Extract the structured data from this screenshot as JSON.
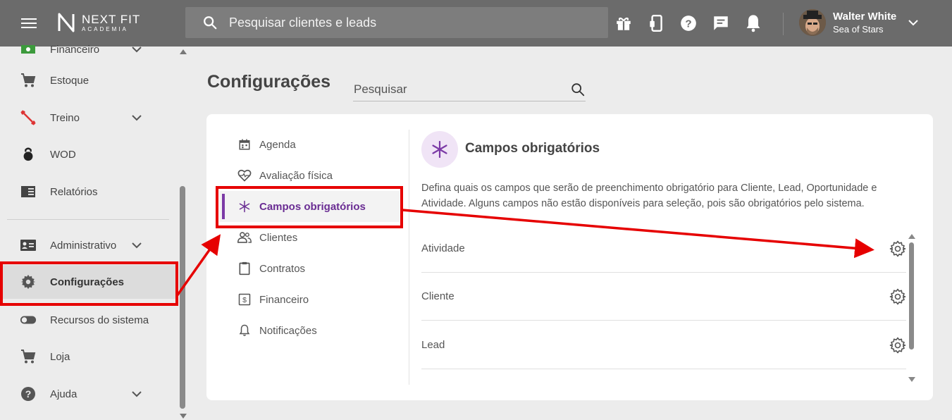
{
  "topbar": {
    "logo_line1": "NEXT FIT",
    "logo_line2": "ACADEMIA",
    "search_placeholder": "Pesquisar clientes e leads",
    "icons": [
      "gift-icon",
      "mobile-icon",
      "help-icon",
      "chat-icon",
      "bell-icon"
    ],
    "user_name": "Walter White",
    "user_org": "Sea of Stars"
  },
  "sidebar": {
    "items": [
      {
        "label": "Financeiro",
        "icon": "money-icon",
        "chevron": true
      },
      {
        "label": "Estoque",
        "icon": "cart-icon",
        "chevron": false
      },
      {
        "label": "Treino",
        "icon": "dumbbell-icon",
        "chevron": true
      },
      {
        "label": "WOD",
        "icon": "kettlebell-icon",
        "chevron": false
      },
      {
        "label": "Relatórios",
        "icon": "report-icon",
        "chevron": false
      },
      {
        "label": "Administrativo",
        "icon": "id-card-icon",
        "chevron": true
      },
      {
        "label": "Configurações",
        "icon": "gear-icon",
        "chevron": false,
        "active": true
      },
      {
        "label": "Recursos do sistema",
        "icon": "toggle-icon",
        "chevron": false
      },
      {
        "label": "Loja",
        "icon": "cart-icon",
        "chevron": false
      },
      {
        "label": "Ajuda",
        "icon": "help-icon",
        "chevron": true
      }
    ]
  },
  "main": {
    "title": "Configurações",
    "search_placeholder": "Pesquisar",
    "nav": [
      {
        "label": "Agenda",
        "icon": "calendar-icon"
      },
      {
        "label": "Avaliação física",
        "icon": "heart-pulse-icon"
      },
      {
        "label": "Campos obrigatórios",
        "icon": "asterisk-icon",
        "active": true
      },
      {
        "label": "Clientes",
        "icon": "users-icon"
      },
      {
        "label": "Contratos",
        "icon": "clipboard-icon"
      },
      {
        "label": "Financeiro",
        "icon": "dollar-icon"
      },
      {
        "label": "Notificações",
        "icon": "bell-icon"
      }
    ],
    "section_title": "Campos obrigatórios",
    "section_desc": "Defina quais os campos que serão de preenchimento obrigatório para Cliente, Lead, Oportunidade e Atividade. Alguns campos não estão disponíveis para seleção, pois são obrigatórios pelo sistema.",
    "rows": [
      "Atividade",
      "Cliente",
      "Lead"
    ]
  },
  "colors": {
    "topbar": "#6b6b6b",
    "accent": "#7b3aa6",
    "annotation": "#e60000"
  }
}
